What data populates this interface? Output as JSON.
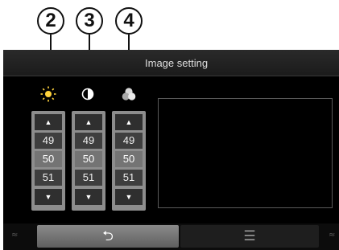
{
  "callouts": [
    "2",
    "3",
    "4"
  ],
  "window": {
    "title": "Image setting"
  },
  "icons": {
    "brightness": "brightness-sun-icon",
    "contrast": "contrast-half-circle-icon",
    "saturation": "color-saturation-icon",
    "back": "back-arrow-icon",
    "menu": "list-menu-icon"
  },
  "controls": [
    {
      "name": "brightness",
      "up": "▲",
      "values": [
        "49",
        "50",
        "51"
      ],
      "selected": "50",
      "down": "▼"
    },
    {
      "name": "contrast",
      "up": "▲",
      "values": [
        "49",
        "50",
        "51"
      ],
      "selected": "50",
      "down": "▼"
    },
    {
      "name": "saturation",
      "up": "▲",
      "values": [
        "49",
        "50",
        "51"
      ],
      "selected": "50",
      "down": "▼"
    }
  ],
  "bottom_bar": {
    "back_glyph": "⮌",
    "menu_glyph": "☰"
  },
  "colors": {
    "screen_bg": "#000000",
    "title_text": "#dedede",
    "sun_icon": "#ffd23c",
    "selected_cell": "#747474",
    "column_frame": "#8d8d8d",
    "back_button": "#8a8a8a"
  }
}
